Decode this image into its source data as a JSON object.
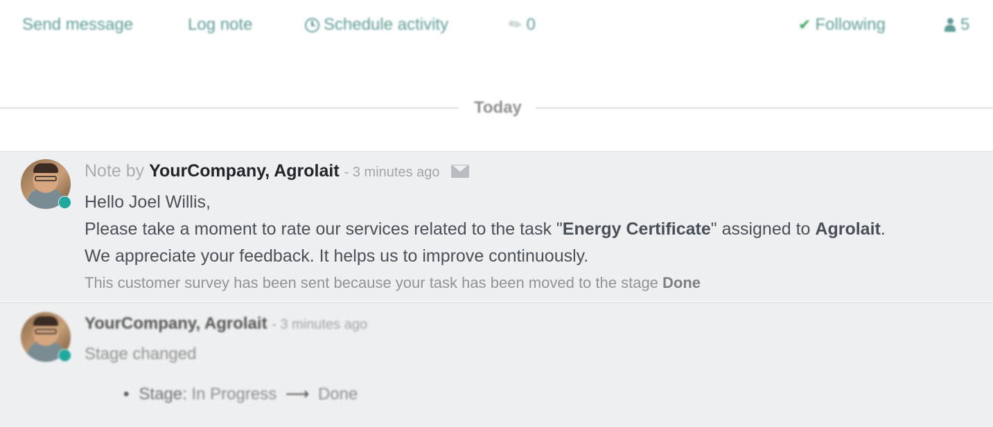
{
  "toolbar": {
    "send_message": "Send message",
    "log_note": "Log note",
    "schedule_activity": "Schedule activity",
    "attachments_count": "0",
    "following": "Following",
    "followers_count": "5",
    "icons": {
      "schedule": "clock-icon",
      "attachments": "paperclip-icon",
      "following": "check-icon",
      "followers": "person-icon"
    }
  },
  "separator": {
    "label": "Today"
  },
  "messages": [
    {
      "type_prefix": "Note by",
      "author": "YourCompany, Agrolait",
      "time": "- 3 minutes ago",
      "icon": "envelope-icon",
      "greeting": "Hello Joel Willis,",
      "line2_prefix": "Please take a moment to rate our services related to the task \"",
      "task_name": "Energy Certificate",
      "line2_middle": "\" assigned to ",
      "assignee": "Agrolait",
      "line2_suffix": ".",
      "line3": "We appreciate your feedback. It helps us to improve continuously.",
      "footer_prefix": "This customer survey has been sent because your task has been moved to the stage ",
      "footer_stage": "Done"
    },
    {
      "author": "YourCompany, Agrolait",
      "time": "- 3 minutes ago",
      "body": "Stage changed",
      "tracking_field": "Stage:",
      "tracking_old": "In Progress",
      "tracking_arrow": "⟶",
      "tracking_new": "Done"
    }
  ],
  "colors": {
    "accent": "#20a89e",
    "online_status": "#20a89e",
    "message_bg": "#eeeff0"
  }
}
